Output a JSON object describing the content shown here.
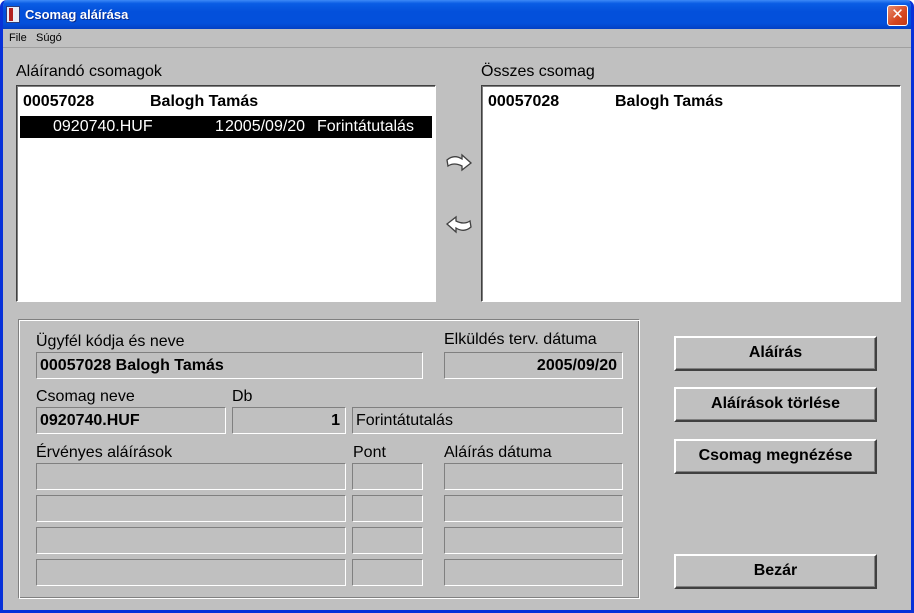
{
  "window": {
    "title": "Csomag aláírása",
    "close_glyph": "✕"
  },
  "menu": [
    "File",
    "Súgó"
  ],
  "left_list": {
    "label": "Aláírandó csomagok",
    "group_row": {
      "code": "00057028",
      "name": "Balogh Tamás"
    },
    "item_row": {
      "file": "0920740.HUF",
      "count": "1",
      "date": "2005/09/20",
      "type": "Forintátutalás"
    }
  },
  "right_list": {
    "label": "Összes csomag",
    "group_row": {
      "code": "00057028",
      "name": "Balogh Tamás"
    }
  },
  "icons": {
    "move_right": "arrow-right-icon",
    "move_left": "arrow-left-icon"
  },
  "details": {
    "client_label": "Ügyfél kódja és neve",
    "client_value": "00057028  Balogh Tamás",
    "send_date_label": "Elküldés terv. dátuma",
    "send_date_value": "2005/09/20",
    "package_name_label": "Csomag neve",
    "package_name_value": "0920740.HUF",
    "db_label": "Db",
    "db_value": "1",
    "transfer_type_value": "Forintátutalás",
    "valid_signatures_label": "Érvényes aláírások",
    "point_label": "Pont",
    "signature_date_label": "Aláírás dátuma"
  },
  "buttons": {
    "sign": "Aláírás",
    "delete_signatures": "Aláírások törlése",
    "view_package": "Csomag megnézése",
    "close": "Bezár"
  }
}
